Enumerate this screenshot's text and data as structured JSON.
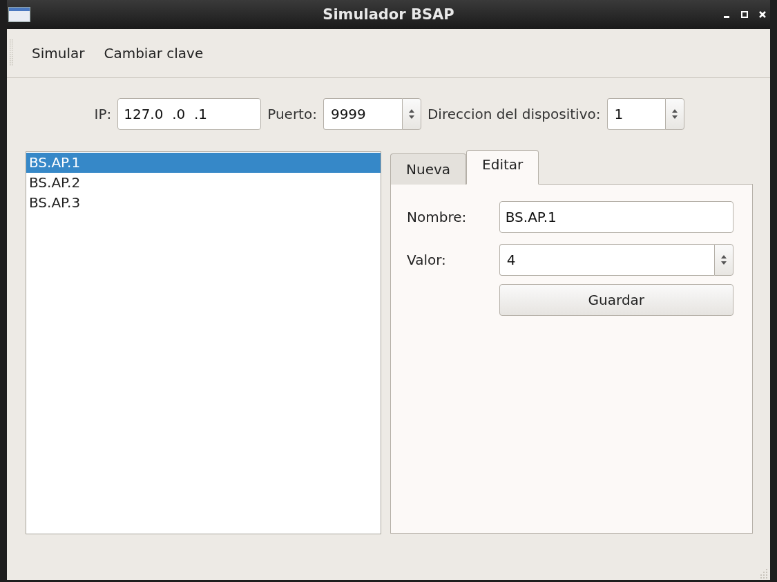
{
  "window": {
    "title": "Simulador BSAP"
  },
  "menu": [
    {
      "label": "Simular"
    },
    {
      "label": "Cambiar clave"
    }
  ],
  "connection": {
    "ip": {
      "label": "IP:",
      "value": "127.0  .0  .1"
    },
    "port": {
      "label": "Puerto:",
      "value": "9999"
    },
    "device": {
      "label": "Direccion del dispositivo:",
      "value": "1"
    }
  },
  "list": [
    {
      "label": "BS.AP.1",
      "selected": true
    },
    {
      "label": "BS.AP.2",
      "selected": false
    },
    {
      "label": "BS.AP.3",
      "selected": false
    }
  ],
  "tabs": [
    {
      "label": "Nueva",
      "selected": false
    },
    {
      "label": "Editar",
      "selected": true
    }
  ],
  "edit_form": {
    "name": {
      "label": "Nombre:",
      "value": "BS.AP.1"
    },
    "value": {
      "label": "Valor:",
      "value": "4"
    },
    "button": "Guardar"
  }
}
